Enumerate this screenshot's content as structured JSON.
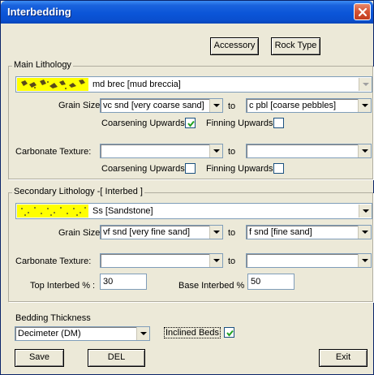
{
  "window": {
    "title": "Interbedding"
  },
  "toolbar": {
    "accessory_label": "Accessory",
    "rock_type_label": "Rock Type"
  },
  "main_lithology": {
    "group_label": "Main Lithology",
    "lithology_value": "md brec [mud breccia]",
    "grain_size_label": "Grain Size:",
    "grain_size_from": "vc snd  [very coarse sand]",
    "to_label": "to",
    "grain_size_to": "c pbl  [coarse pebbles]",
    "coarsening_label": "Coarsening Upwards",
    "coarsening_checked": true,
    "finning_label": "Finning Upwards",
    "finning_checked": false,
    "carbonate_label": "Carbonate Texture:",
    "carbonate_from": "",
    "carbonate_to": "",
    "carb_coarsening_label": "Coarsening Upwards",
    "carb_coarsening_checked": false,
    "carb_finning_label": "Finning Upwards",
    "carb_finning_checked": false
  },
  "secondary_lithology": {
    "group_label": "Secondary Lithology -[ Interbed ]",
    "lithology_value": "Ss [Sandstone]",
    "grain_size_label": "Grain Size:",
    "grain_size_from": "vf snd  [very fine sand]",
    "to_label": "to",
    "grain_size_to": "f snd  [fine sand]",
    "carbonate_label": "Carbonate Texture:",
    "carbonate_from": "",
    "carbonate_to": "",
    "top_interbed_label": "Top Interbed % :",
    "top_interbed_value": "30",
    "base_interbed_label": "Base Interbed % :",
    "base_interbed_value": "50"
  },
  "bedding": {
    "label": "Bedding Thickness",
    "value": "Decimeter (DM)",
    "inclined_label": "Inclined Beds",
    "inclined_checked": true
  },
  "footer": {
    "save_label": "Save",
    "del_label": "DEL",
    "exit_label": "Exit"
  },
  "colors": {
    "title_bar": "#0b55d8",
    "dialog_bg": "#ece9d8",
    "lithology_swatch": "#ffff00",
    "close_button": "#d45233"
  }
}
